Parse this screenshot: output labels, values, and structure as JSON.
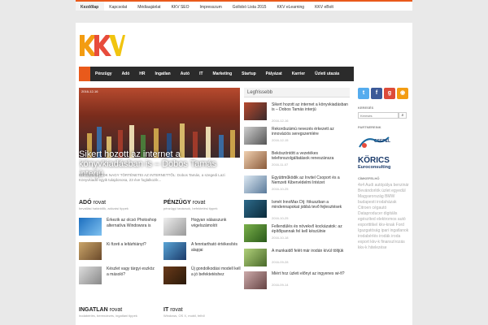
{
  "top_nav": [
    "Kezdőlap",
    "Kapcsolat",
    "Médiaajánlat",
    "KKV SEO",
    "Impresszum",
    "Gollobó Lista 2015",
    "KKV eLearning",
    "KKV eBolt"
  ],
  "logo": {
    "text": "KKV",
    "colors": [
      "#f39c12",
      "#e74c3c",
      "#f1c40f"
    ]
  },
  "main_nav": [
    "Pénzügy",
    "Adó",
    "HR",
    "Ingatlan",
    "Autó",
    "IT",
    "Marketing",
    "Startup",
    "Pályázat",
    "Karrier",
    "Üzleti utazás"
  ],
  "hero": {
    "date": "2016-12-16",
    "title": "Sikert hozott az internet a könyvkiadásban is – Dobos Tamás interjú",
    "excerpt": "KISVÁLLALATOK NAGY TÖRTÉNETEI AZ INTERNETTŐL: Dobos Tamás, a szegedi Lazi Könyvkiadó egyik tulajdonosa, 23 éve foglalkozik..."
  },
  "sections": [
    {
      "title": "ADÓ",
      "rovat": "rovat",
      "subtitle": "bevallási határidők, adózási tippek",
      "items": [
        "Érkezik az olcsó Photoshop alternatíva Windowsra is",
        "Ki fizeti a leltárhiányt?",
        "Készlet vagy tárgyi eszköz a másoló?"
      ]
    },
    {
      "title": "PÉNZÜGY",
      "rovat": "rovat",
      "subtitle": "pénzügyi tanácsok, befektetési tippek",
      "items": [
        "Hogyan válasszunk végelszámolót",
        "A fenntartható értékesítés alapjai",
        "Új gondolkodási modell kell a jó befektetéshez"
      ]
    },
    {
      "title": "INGATLAN",
      "rovat": "rovat",
      "subtitle": "irodabérlés, berendezés, ingatlani tippek",
      "items": []
    },
    {
      "title": "IT",
      "rovat": "rovat",
      "subtitle": "Windows, OS X, mobil, felhő",
      "items": []
    }
  ],
  "latest": {
    "header": "Legfrissebb",
    "items": [
      {
        "title": "Sikert hozott az internet a könyvkiadásban is – Dobos Tamás interjú",
        "date": "2016-12-16"
      },
      {
        "title": "Rekordszámú nevezés érkezett az innovációs seregszemlére",
        "date": "2016-12-15"
      },
      {
        "title": "Beköszöntött a vezetékes telefonszolgáltatások reneszánsza",
        "date": "2016-11-07"
      },
      {
        "title": "Együttműködik az Invitel Csoport és a Nemzeti Kibervédelmi Intézet",
        "date": "2016-10-25"
      },
      {
        "title": "Ismét InnoMax Díj: fókuszban a mindennapokat jobbá tevő fejlesztések",
        "date": "2016-10-25"
      },
      {
        "title": "Fellendülés és növekvő kockázatok: az építőipannak fel kell készülnie",
        "date": "2016-10-18"
      },
      {
        "title": "A munkaidő felét már irodán kívül töltjük",
        "date": "2016-09-28"
      },
      {
        "title": "Miért hoz üzleti előnyt az ingyenes wi-fi?",
        "date": "2016-09-14"
      }
    ]
  },
  "sidebar": {
    "search_label": "KERESÉS",
    "search_placeholder": "Keresés",
    "partners_label": "PARTNEREINK",
    "partner1": "CSEPEL",
    "partner2_line1": "KÖRICS",
    "partner2_line2": "Euroconsulting",
    "tags_label": "CÍMKEFELHŐ",
    "tags": "4x4 Audi autópálya benzinár Bevándorlók üzlet egyedül Magyarország BMW budapesti irodaházak Citroen cégautó Dataproducer digitális egészíted elektromos autó exporttitkel kkv-knak Ford Igazgatóság ipari ingatlanok irodabérlés irodák iroda export kkv-k finanszírozás kkv-k hitelezése"
  },
  "colors": {
    "accent": "#e95a1b",
    "nav_bg": "#2b2b2b"
  }
}
